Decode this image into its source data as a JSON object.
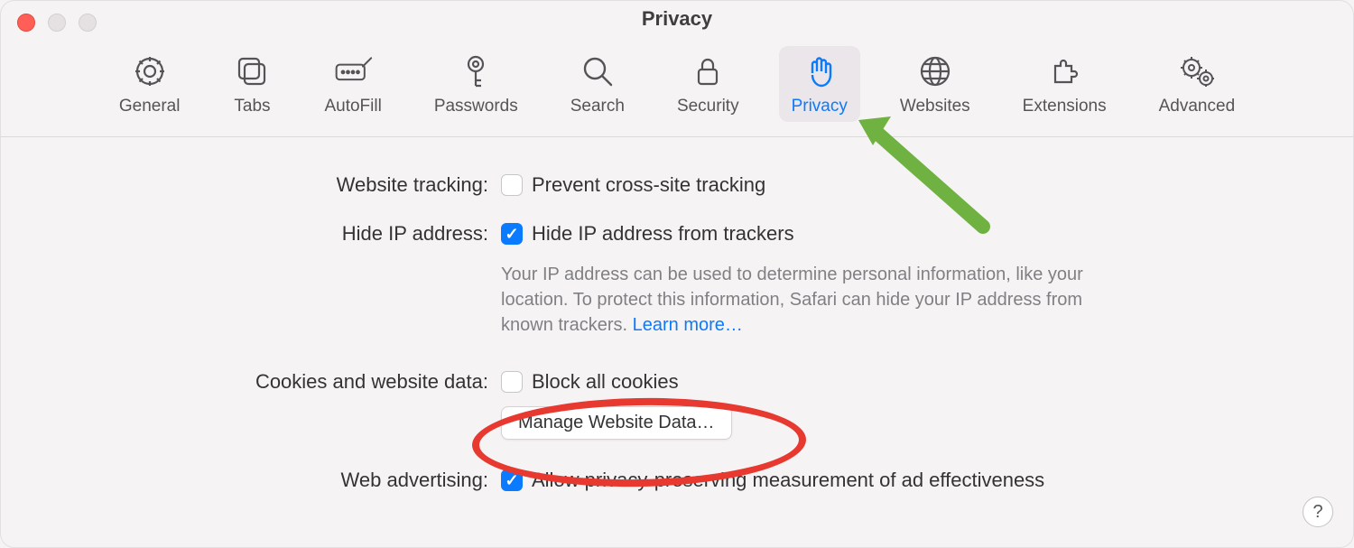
{
  "window": {
    "title": "Privacy"
  },
  "tabs": {
    "general": "General",
    "tabs": "Tabs",
    "autofill": "AutoFill",
    "passwords": "Passwords",
    "search": "Search",
    "security": "Security",
    "privacy": "Privacy",
    "websites": "Websites",
    "extensions": "Extensions",
    "advanced": "Advanced"
  },
  "rows": {
    "tracking": {
      "label": "Website tracking:",
      "option": "Prevent cross-site tracking"
    },
    "hideip": {
      "label": "Hide IP address:",
      "option": "Hide IP address from trackers",
      "desc": "Your IP address can be used to determine personal information, like your location. To protect this information, Safari can hide your IP address from known trackers. ",
      "learn": "Learn more…"
    },
    "cookies": {
      "label": "Cookies and website data:",
      "option": "Block all cookies",
      "button": "Manage Website Data…"
    },
    "ads": {
      "label": "Web advertising:",
      "option": "Allow privacy-preserving measurement of ad effectiveness"
    }
  },
  "help": "?"
}
